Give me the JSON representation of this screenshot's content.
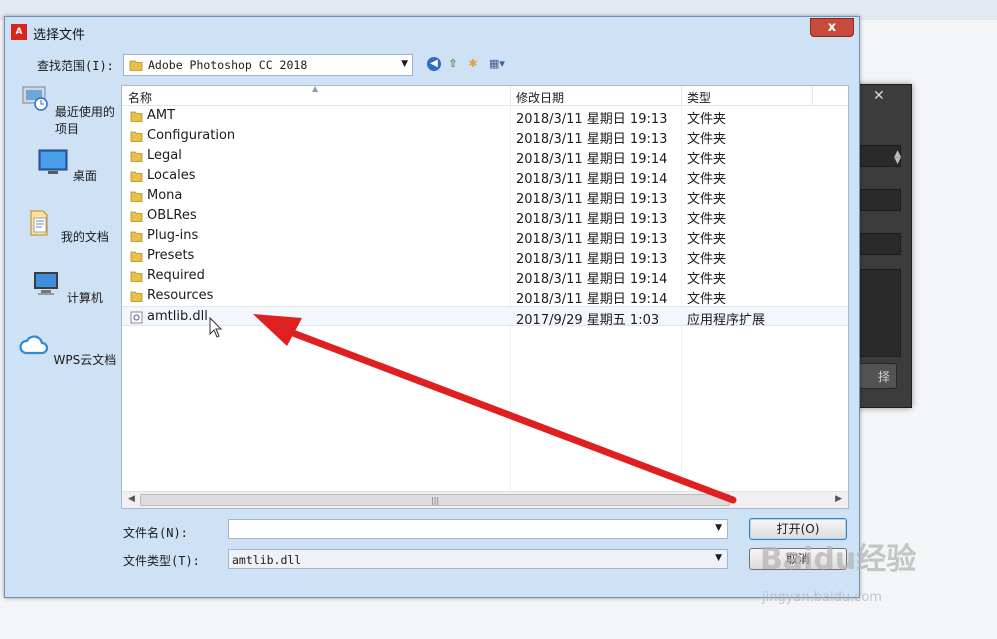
{
  "window": {
    "title": "选择文件",
    "close_glyph": "x",
    "app_icon": "adobe-icon"
  },
  "toolbar": {
    "look_in_label": "查找范围(I):",
    "look_in_value": "Adobe Photoshop CC 2018",
    "icons": [
      "back-icon",
      "up-folder-icon",
      "new-folder-icon",
      "view-menu-icon"
    ]
  },
  "places": [
    {
      "label": "最近使用的项目",
      "icon": "recent-icon"
    },
    {
      "label": "桌面",
      "icon": "desktop-icon"
    },
    {
      "label": "我的文档",
      "icon": "documents-icon"
    },
    {
      "label": "计算机",
      "icon": "computer-icon"
    },
    {
      "label": "WPS云文档",
      "icon": "cloud-icon"
    }
  ],
  "columns": {
    "name": "名称",
    "modified": "修改日期",
    "type": "类型"
  },
  "files": [
    {
      "name": "AMT",
      "modified": "2018/3/11 星期日 19:13",
      "type": "文件夹",
      "kind": "folder"
    },
    {
      "name": "Configuration",
      "modified": "2018/3/11 星期日 19:13",
      "type": "文件夹",
      "kind": "folder"
    },
    {
      "name": "Legal",
      "modified": "2018/3/11 星期日 19:14",
      "type": "文件夹",
      "kind": "folder"
    },
    {
      "name": "Locales",
      "modified": "2018/3/11 星期日 19:14",
      "type": "文件夹",
      "kind": "folder"
    },
    {
      "name": "Mona",
      "modified": "2018/3/11 星期日 19:13",
      "type": "文件夹",
      "kind": "folder"
    },
    {
      "name": "OBLRes",
      "modified": "2018/3/11 星期日 19:13",
      "type": "文件夹",
      "kind": "folder"
    },
    {
      "name": "Plug-ins",
      "modified": "2018/3/11 星期日 19:13",
      "type": "文件夹",
      "kind": "folder"
    },
    {
      "name": "Presets",
      "modified": "2018/3/11 星期日 19:13",
      "type": "文件夹",
      "kind": "folder"
    },
    {
      "name": "Required",
      "modified": "2018/3/11 星期日 19:14",
      "type": "文件夹",
      "kind": "folder"
    },
    {
      "name": "Resources",
      "modified": "2018/3/11 星期日 19:14",
      "type": "文件夹",
      "kind": "folder"
    },
    {
      "name": "amtlib.dll",
      "modified": "2017/9/29 星期五 1:03",
      "type": "应用程序扩展",
      "kind": "dll"
    }
  ],
  "form": {
    "filename_label": "文件名(N):",
    "filename_value": "",
    "filetype_label": "文件类型(T):",
    "filetype_value": "amtlib.dll",
    "open_label": "打开(O)",
    "cancel_label": "取消"
  },
  "background_dialog": {
    "button_fragment": "择"
  },
  "watermark": {
    "main": "Baidu经验",
    "url": "jingyan.baidu.com"
  },
  "colors": {
    "annotation_arrow": "#e02020",
    "title_close": "#c74a3d",
    "dialog_frame": "#cfe1f5"
  }
}
